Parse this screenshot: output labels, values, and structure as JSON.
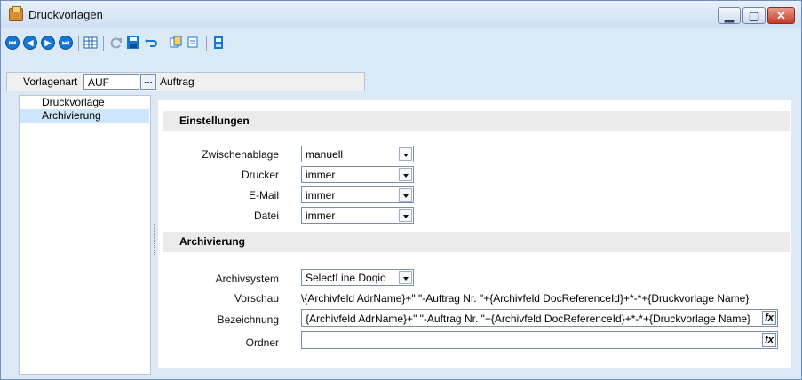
{
  "window": {
    "title": "Druckvorlagen",
    "buttons": [
      "▁",
      "▢",
      "✕"
    ]
  },
  "toolbar": {
    "nav": [
      "⏮",
      "◀",
      "▶",
      "⏭"
    ],
    "icons": [
      "table-icon",
      "refresh-icon",
      "save-icon",
      "undo-icon",
      "copy-icon",
      "print-preview-icon",
      "document-icon"
    ]
  },
  "vorlage": {
    "label": "Vorlagenart",
    "value": "AUF",
    "lookup": "...",
    "description": "Auftrag"
  },
  "tree": {
    "items": [
      "Druckvorlage",
      "Archivierung"
    ]
  },
  "settings": {
    "header": "Einstellungen",
    "rows": [
      {
        "label": "Zwischenablage",
        "value": "manuell"
      },
      {
        "label": "Drucker",
        "value": "immer"
      },
      {
        "label": "E-Mail",
        "value": "immer"
      },
      {
        "label": "Datei",
        "value": "immer"
      }
    ]
  },
  "archiving": {
    "header": "Archivierung",
    "system_label": "Archivsystem",
    "system_value": "SelectLine Doqio",
    "preview_label": "Vorschau",
    "preview_value": "\\{Archivfeld AdrName}+\" \"-Auftrag Nr. \"+{Archivfeld DocReferenceId}+*-*+{Druckvorlage Name}",
    "description_label": "Bezeichnung",
    "description_value": "{Archivfeld AdrName}+\" \"-Auftrag Nr. \"+{Archivfeld DocReferenceId}+*-*+{Druckvorlage Name}",
    "folder_label": "Ordner",
    "folder_value": "",
    "fx_label": "fx"
  }
}
